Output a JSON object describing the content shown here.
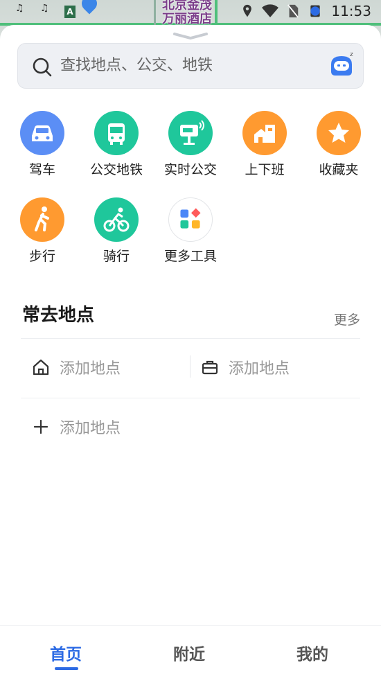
{
  "status_bar": {
    "time": "11:53"
  },
  "map": {
    "poi_label": "北京金茂\n万丽酒店",
    "metro_letter": "A"
  },
  "search": {
    "placeholder": "查找地点、公交、地铁"
  },
  "tools": [
    {
      "label": "驾车",
      "icon": "car-icon",
      "color": "#5b8ef5"
    },
    {
      "label": "公交地铁",
      "icon": "bus-icon",
      "color": "#1fc79b"
    },
    {
      "label": "实时公交",
      "icon": "bus-stop-icon",
      "color": "#1fc79b"
    },
    {
      "label": "上下班",
      "icon": "commute-icon",
      "color": "#ff9a30"
    },
    {
      "label": "收藏夹",
      "icon": "star-icon",
      "color": "#ff9a30"
    },
    {
      "label": "步行",
      "icon": "walk-icon",
      "color": "#ff9a30"
    },
    {
      "label": "骑行",
      "icon": "bike-icon",
      "color": "#1fc79b"
    },
    {
      "label": "更多工具",
      "icon": "more-tools-icon",
      "color": "#ffffff"
    }
  ],
  "frequent": {
    "title": "常去地点",
    "more": "更多",
    "home_label": "添加地点",
    "work_label": "添加地点",
    "add_label": "添加地点"
  },
  "tabs": [
    {
      "label": "首页",
      "active": true
    },
    {
      "label": "附近",
      "active": false
    },
    {
      "label": "我的",
      "active": false
    }
  ],
  "colors": {
    "accent": "#2d6be4",
    "green": "#1fc79b",
    "orange": "#ff9a30",
    "blue": "#5b8ef5"
  }
}
